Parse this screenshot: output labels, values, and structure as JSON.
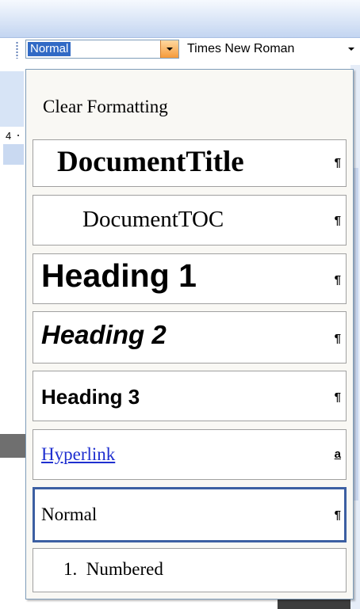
{
  "toolbar": {
    "style_box_value": "Normal",
    "font_box_value": "Times New Roman"
  },
  "ruler": {
    "number": "4"
  },
  "style_menu": {
    "clear_formatting": "Clear Formatting",
    "items": [
      {
        "label": "DocumentTitle",
        "mark": "¶"
      },
      {
        "label": "DocumentTOC",
        "mark": "¶"
      },
      {
        "label": "Heading 1",
        "mark": "¶"
      },
      {
        "label": "Heading 2",
        "mark": "¶"
      },
      {
        "label": "Heading 3",
        "mark": "¶"
      },
      {
        "label": "Hyperlink",
        "mark": "a"
      },
      {
        "label": "Normal",
        "mark": "¶"
      },
      {
        "label": "1.  Numbered"
      }
    ],
    "selected": "Normal"
  },
  "colors": {
    "selection": "#316ac5",
    "dropdown_button": "#f59a3a",
    "selected_border": "#3c5fa2",
    "hyperlink": "#1f2fd0"
  }
}
